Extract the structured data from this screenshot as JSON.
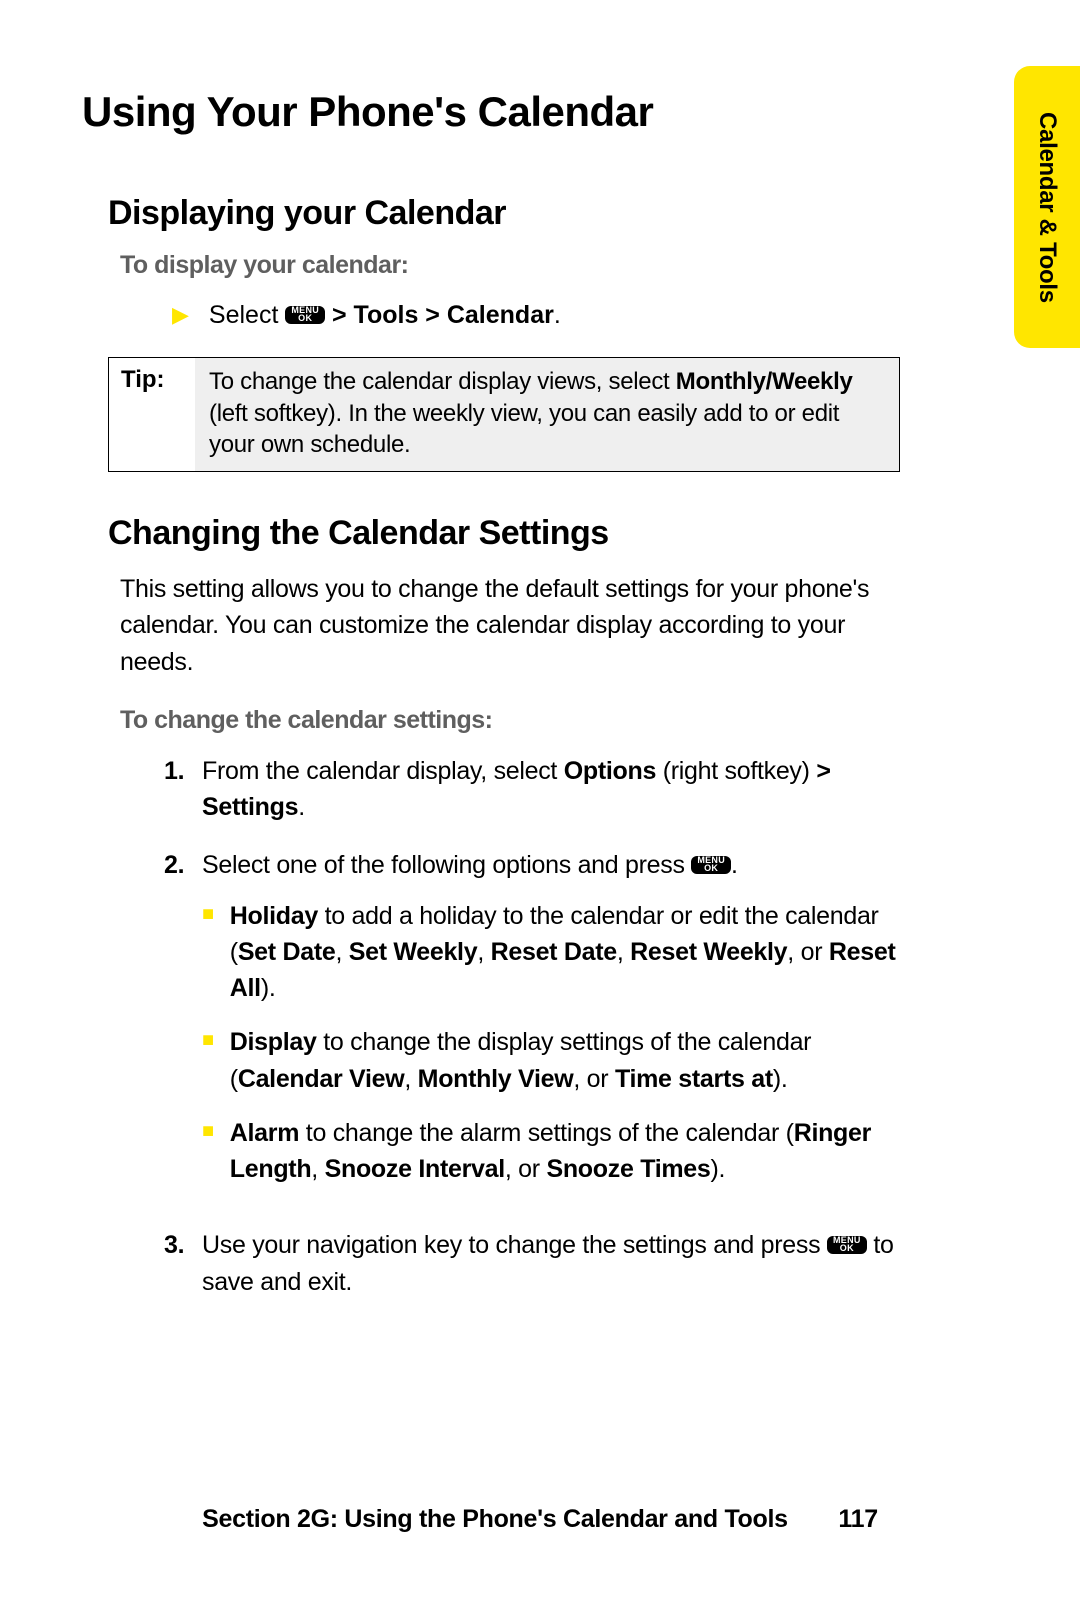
{
  "sideTab": "Calendar & Tools",
  "h1": "Using Your Phone's Calendar",
  "sec1": {
    "h2": "Displaying your Calendar",
    "lead": "To display your calendar:",
    "step_prefix": "Select ",
    "step_path": " > Tools > Calendar"
  },
  "tip": {
    "label": "Tip:",
    "text_before": "To change the calendar display views, select ",
    "bold": "Monthly/Weekly",
    "text_after": " (left softkey). In the weekly view, you can easily add to or edit your own schedule."
  },
  "sec2": {
    "h2": "Changing the Calendar Settings",
    "para": "This setting allows you to change the default settings for your phone's calendar. You can customize the calendar display according to your needs.",
    "lead": "To change the calendar settings:"
  },
  "steps": {
    "s1": {
      "num": "1.",
      "a": "From the calendar display, select ",
      "b": "Options",
      "c": " (right softkey) ",
      "d": "> Settings",
      "e": "."
    },
    "s2": {
      "num": "2.",
      "a": "Select one of the following options and press ",
      "b": "."
    },
    "sub": {
      "holiday": {
        "b1": "Holiday",
        "t1": " to add a holiday to the calendar or edit the calendar (",
        "b2": "Set Date",
        "t2": ", ",
        "b3": "Set Weekly",
        "t3": ", ",
        "b4": "Reset Date",
        "t4": ", ",
        "b5": "Reset Weekly",
        "t5": ", or ",
        "b6": "Reset All",
        "t6": ")."
      },
      "display": {
        "b1": "Display",
        "t1": " to change the display settings of the calendar (",
        "b2": "Calendar View",
        "t2": ", ",
        "b3": "Monthly View",
        "t3": ", or ",
        "b4": "Time starts at",
        "t4": ")."
      },
      "alarm": {
        "b1": "Alarm",
        "t1": " to change the alarm settings of the calendar (",
        "b2": "Ringer Length",
        "t2": ", ",
        "b3": "Snooze Interval",
        "t3": ", or ",
        "b4": "Snooze Times",
        "t4": ")."
      }
    },
    "s3": {
      "num": "3.",
      "a": "Use your navigation key to change the settings and press ",
      "b": " to save and exit."
    }
  },
  "footer": {
    "section": "Section 2G: Using the Phone's Calendar and Tools",
    "page": "117"
  },
  "menuKey": {
    "top": "MENU",
    "bot": "OK"
  }
}
